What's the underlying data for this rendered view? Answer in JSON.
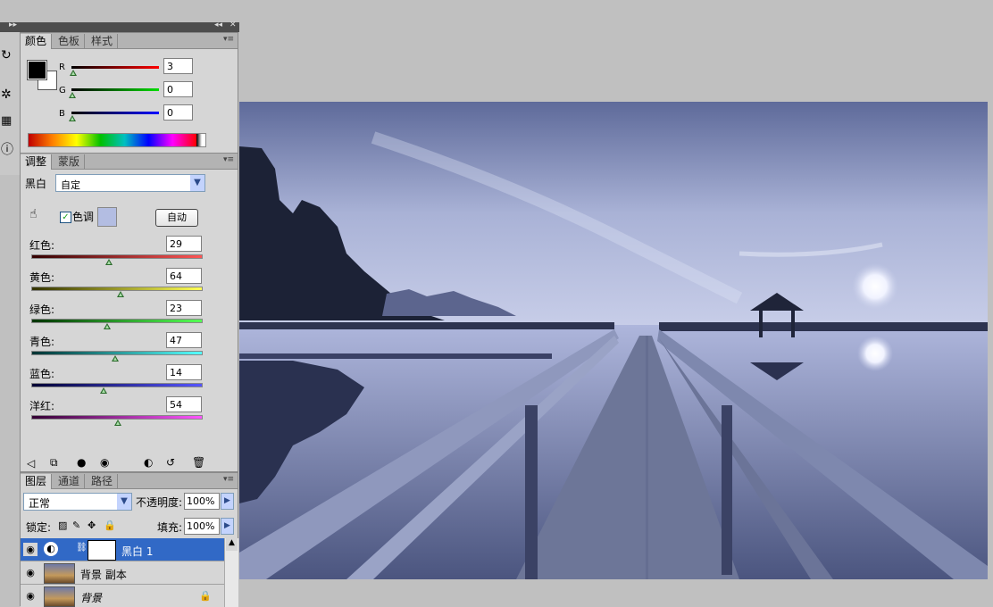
{
  "colors": {
    "workspace": "#c0c0c0",
    "panel": "#d6d6d6",
    "selected_layer": "#3169c6"
  },
  "color_panel": {
    "tabs": [
      "颜色",
      "色板",
      "样式"
    ],
    "channels": [
      {
        "label": "R",
        "value": "3"
      },
      {
        "label": "G",
        "value": "0"
      },
      {
        "label": "B",
        "value": "0"
      }
    ]
  },
  "adjust_panel": {
    "tabs": [
      "调整",
      "蒙版"
    ],
    "title": "黑白",
    "preset": "自定",
    "tint_label": "色调",
    "auto_button": "自动",
    "sliders": [
      {
        "label": "红色:",
        "value": "29"
      },
      {
        "label": "黄色:",
        "value": "64"
      },
      {
        "label": "绿色:",
        "value": "23"
      },
      {
        "label": "青色:",
        "value": "47"
      },
      {
        "label": "蓝色:",
        "value": "14"
      },
      {
        "label": "洋红:",
        "value": "54"
      }
    ]
  },
  "layers_panel": {
    "tabs": [
      "图层",
      "通道",
      "路径"
    ],
    "blend_mode": "正常",
    "opacity_label": "不透明度:",
    "opacity_value": "100%",
    "lock_label": "锁定:",
    "fill_label": "填充:",
    "fill_value": "100%",
    "layers": [
      {
        "name": "黑白 1"
      },
      {
        "name": "背景 副本"
      },
      {
        "name": "背景"
      }
    ]
  }
}
